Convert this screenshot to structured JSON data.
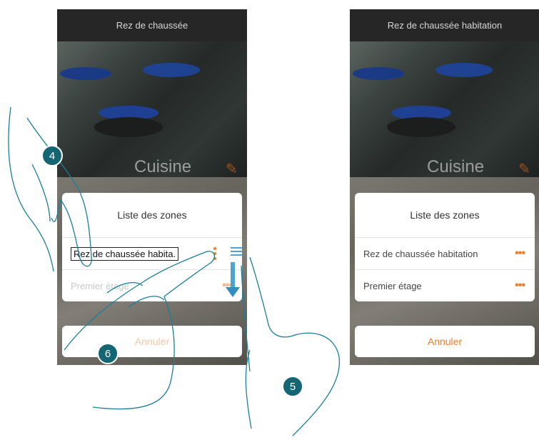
{
  "left_screen": {
    "header_title": "Rez de chaussée",
    "tile_label": "Cuisine",
    "sheet_title": "Liste des zones",
    "edit_field_value": "Rez de chaussée habita.",
    "row2_label": "Premier étage",
    "cancel_label": "Annuler"
  },
  "right_screen": {
    "header_title": "Rez de chaussée habitation",
    "tile_label": "Cuisine",
    "sheet_title": "Liste des zones",
    "rows": [
      {
        "label": "Rez de chaussée habitation"
      },
      {
        "label": "Premier étage"
      }
    ],
    "cancel_label": "Annuler"
  },
  "step_badges": {
    "step4": "4",
    "step5": "5",
    "step6": "6"
  },
  "colors": {
    "accent": "#ee7f2f",
    "badge": "#156675",
    "drag_indicator": "#4da5cf",
    "header": "#262626"
  },
  "icons": {
    "edit": "pencil-icon",
    "more": "more-dots-icon",
    "drag": "drag-handle-icon",
    "arrow": "arrow-down-icon"
  }
}
